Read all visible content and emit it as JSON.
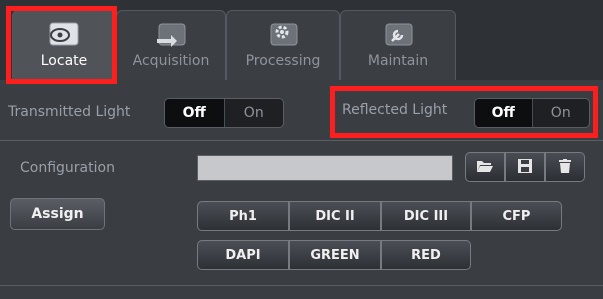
{
  "tabs": [
    {
      "label": "Locate",
      "icon": "eye-icon"
    },
    {
      "label": "Acquisition",
      "icon": "acquisition-arrow-icon"
    },
    {
      "label": "Processing",
      "icon": "processing-gear-icon"
    },
    {
      "label": "Maintain",
      "icon": "wrench-icon"
    }
  ],
  "transmitted": {
    "label": "Transmitted Light",
    "off": "Off",
    "on": "On",
    "selected": "Off"
  },
  "reflected": {
    "label": "Reflected Light",
    "off": "Off",
    "on": "On",
    "selected": "Off"
  },
  "configuration": {
    "label": "Configuration",
    "value": ""
  },
  "assign_label": "Assign",
  "filters_row1": [
    "Ph1",
    "DIC II",
    "DIC III",
    "CFP"
  ],
  "filters_row2": [
    "DAPI",
    "GREEN",
    "RED"
  ],
  "colors": {
    "highlight": "#ff1e1e",
    "panel": "#3a3d42"
  }
}
